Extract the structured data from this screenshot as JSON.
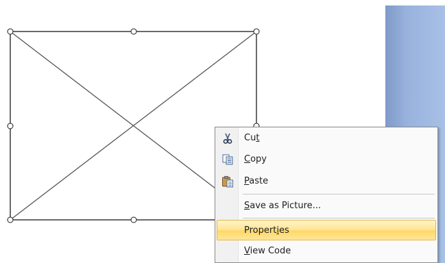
{
  "context_menu": {
    "items": [
      {
        "before": "Cu",
        "access_key": "t",
        "after": "",
        "icon": "scissors-icon",
        "highlighted": false
      },
      {
        "before": "",
        "access_key": "C",
        "after": "opy",
        "icon": "copy-icon",
        "highlighted": false
      },
      {
        "before": "",
        "access_key": "P",
        "after": "aste",
        "icon": "paste-icon",
        "highlighted": false
      },
      {
        "before": "",
        "access_key": "S",
        "after": "ave as Picture...",
        "icon": "",
        "highlighted": false
      },
      {
        "before": "Propert",
        "access_key": "i",
        "after": "es",
        "icon": "",
        "highlighted": true
      },
      {
        "before": "",
        "access_key": "V",
        "after": "iew Code",
        "icon": "",
        "highlighted": false
      }
    ]
  },
  "colors": {
    "highlight": "#ffd866",
    "panel_blue": "#98b2dd"
  }
}
